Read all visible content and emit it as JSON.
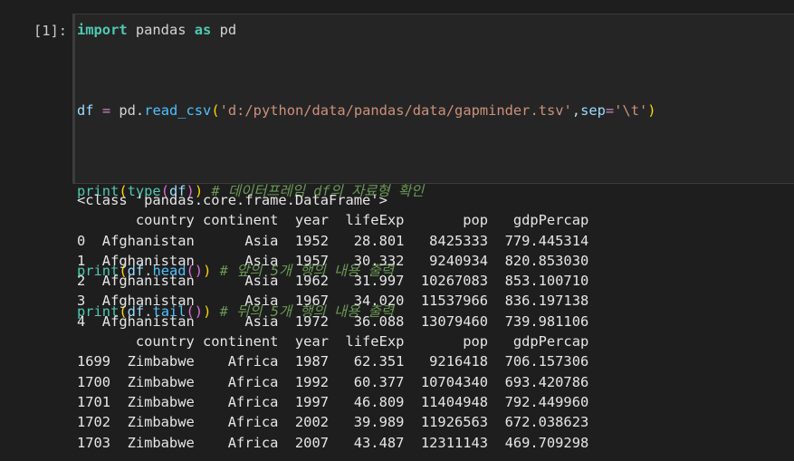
{
  "prompt": "[1]:",
  "code": {
    "line1": {
      "kw_import": "import",
      "module": " pandas ",
      "kw_as": "as",
      "alias": " pd"
    },
    "line2": {
      "var": "df",
      "op": " = ",
      "obj": "pd",
      "dot": ".",
      "fn": "read_csv",
      "open": "(",
      "path": "'d:/python/data/pandas/data/gapminder.tsv'",
      "comma": ",",
      "kwarg": "sep",
      "eq": "=",
      "sep": "'\\t'",
      "close": ")"
    },
    "line3": {
      "fn": "print",
      "open": "(",
      "inner_fn": "type",
      "inner_open": "(",
      "arg": "df",
      "inner_close": ")",
      "close": ")",
      "comment": " # 데이터프레임 df의 자료형 확인"
    },
    "line4": {
      "fn": "print",
      "open": "(",
      "obj": "df",
      "dot": ".",
      "meth": "head",
      "call": "()",
      "close": ")",
      "comment": " # 앞의 5개 행의 내용 출력"
    },
    "line5": {
      "fn": "print",
      "open": "(",
      "obj": "df",
      "dot": ".",
      "meth": "tail",
      "call": "()",
      "close": ")",
      "comment": " # 뒤의 5개 행의 내용 출력"
    }
  },
  "output": {
    "type_line": "<class 'pandas.core.frame.DataFrame'>",
    "head_header": "       country continent  year  lifeExp       pop   gdpPercap",
    "head_rows": [
      "0  Afghanistan      Asia  1952   28.801   8425333  779.445314",
      "1  Afghanistan      Asia  1957   30.332   9240934  820.853030",
      "2  Afghanistan      Asia  1962   31.997  10267083  853.100710",
      "3  Afghanistan      Asia  1967   34.020  11537966  836.197138",
      "4  Afghanistan      Asia  1972   36.088  13079460  739.981106"
    ],
    "tail_header": "       country continent  year  lifeExp       pop   gdpPercap",
    "tail_rows": [
      "1699  Zimbabwe    Africa  1987   62.351   9216418  706.157306",
      "1700  Zimbabwe    Africa  1992   60.377  10704340  693.420786",
      "1701  Zimbabwe    Africa  1997   46.809  11404948  792.449960",
      "1702  Zimbabwe    Africa  2002   39.989  11926563  672.038623",
      "1703  Zimbabwe    Africa  2007   43.487  12311143  469.709298"
    ]
  }
}
